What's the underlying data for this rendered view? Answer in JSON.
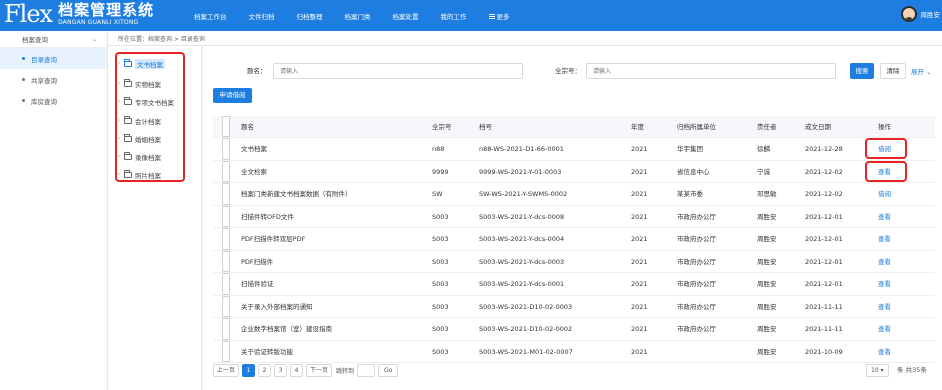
{
  "header": {
    "logo_mark": "Flex",
    "logo_title": "档案管理系统",
    "logo_sub": "DANGAN GUANLI XITONG",
    "nav": [
      "档案工作台",
      "文件归档",
      "归档整理",
      "档案门类",
      "档案处置",
      "我的工作",
      "更多"
    ],
    "user_name": "周胜安"
  },
  "sidebar": {
    "section": "档案查询",
    "items": [
      {
        "label": "目录查询",
        "active": true
      },
      {
        "label": "共享查询",
        "active": false
      },
      {
        "label": "库房查询",
        "active": false
      }
    ]
  },
  "breadcrumb": "所在位置：档案查询 > 目录查询",
  "tree": {
    "items": [
      {
        "label": "文书档案",
        "selected": true
      },
      {
        "label": "实物档案",
        "selected": false
      },
      {
        "label": "专项文书档案",
        "selected": false
      },
      {
        "label": "会计档案",
        "selected": false
      },
      {
        "label": "婚姻档案",
        "selected": false
      },
      {
        "label": "录像档案",
        "selected": false
      },
      {
        "label": "照片档案",
        "selected": false
      }
    ]
  },
  "search": {
    "title_label": "题名：",
    "title_placeholder": "请输入",
    "fonds_label": "全宗号：",
    "fonds_placeholder": "请输入",
    "search_button": "搜索",
    "clear_button": "清除",
    "expand_link": "展开 ⌄",
    "borrow_button": "申请借阅"
  },
  "table": {
    "headers": {
      "title": "题名",
      "fonds": "全宗号",
      "code": "档号",
      "year": "年度",
      "unit": "归档所属单位",
      "person": "责任者",
      "date": "成文日期",
      "op": "操作"
    },
    "rows": [
      {
        "title": "文书档案",
        "fonds": "n88",
        "code": "n88-WS-2021-D1-66-0001",
        "year": "2021",
        "unit": "华宇集团",
        "person": "徐麟",
        "date": "2021-12-28",
        "op": "借阅"
      },
      {
        "title": "全文检索",
        "fonds": "9999",
        "code": "9999-WS-2021-Y-01-0003",
        "year": "2021",
        "unit": "省信息中心",
        "person": "宁诚",
        "date": "2021-12-02",
        "op": "查看"
      },
      {
        "title": "档案门类新建文书档案数据（有附件）",
        "fonds": "SW",
        "code": "SW-WS-2021-Y-SWMS-0002",
        "year": "2021",
        "unit": "某某市委",
        "person": "邓思敏",
        "date": "2021-12-02",
        "op": "借阅"
      },
      {
        "title": "扫描件转OFD文件",
        "fonds": "S003",
        "code": "S003-WS-2021-Y-dcs-0008",
        "year": "2021",
        "unit": "市政府办公厅",
        "person": "周胜安",
        "date": "2021-12-01",
        "op": "查看"
      },
      {
        "title": "PDF扫描件转双层PDF",
        "fonds": "S003",
        "code": "S003-WS-2021-Y-dcs-0004",
        "year": "2021",
        "unit": "市政府办公厅",
        "person": "周胜安",
        "date": "2021-12-01",
        "op": "查看"
      },
      {
        "title": "PDF扫描件",
        "fonds": "S003",
        "code": "S003-WS-2021-Y-dcs-0003",
        "year": "2021",
        "unit": "市政府办公厅",
        "person": "周胜安",
        "date": "2021-12-01",
        "op": "查看"
      },
      {
        "title": "扫描件验证",
        "fonds": "S003",
        "code": "S003-WS-2021-Y-dcs-0001",
        "year": "2021",
        "unit": "市政府办公厅",
        "person": "周胜安",
        "date": "2021-12-01",
        "op": "查看"
      },
      {
        "title": "关于录入外部档案的通知",
        "fonds": "S003",
        "code": "S003-WS-2021-D10-02-0003",
        "year": "2021",
        "unit": "市政府办公厅",
        "person": "周胜安",
        "date": "2021-11-11",
        "op": "查看"
      },
      {
        "title": "企业数字档案馆（室）建设指南",
        "fonds": "S003",
        "code": "S003-WS-2021-D10-02-0002",
        "year": "2021",
        "unit": "市政府办公厅",
        "person": "周胜安",
        "date": "2021-11-11",
        "op": "查看"
      },
      {
        "title": "关于验证转版功能",
        "fonds": "S003",
        "code": "S003-WS-2021-M01-02-0007",
        "year": "2021",
        "unit": "",
        "person": "周胜安",
        "date": "2021-10-09",
        "op": "查看"
      }
    ]
  },
  "pagination": {
    "prev": "上一页",
    "pages": [
      "1",
      "2",
      "3",
      "4"
    ],
    "current": "1",
    "next": "下一页",
    "jump_label": "跳转到",
    "go": "Go",
    "page_size": "10 ▾",
    "unit": "条",
    "total": "共35条"
  },
  "colors": {
    "primary": "#1e7de0",
    "highlight_border": "#e82323"
  }
}
